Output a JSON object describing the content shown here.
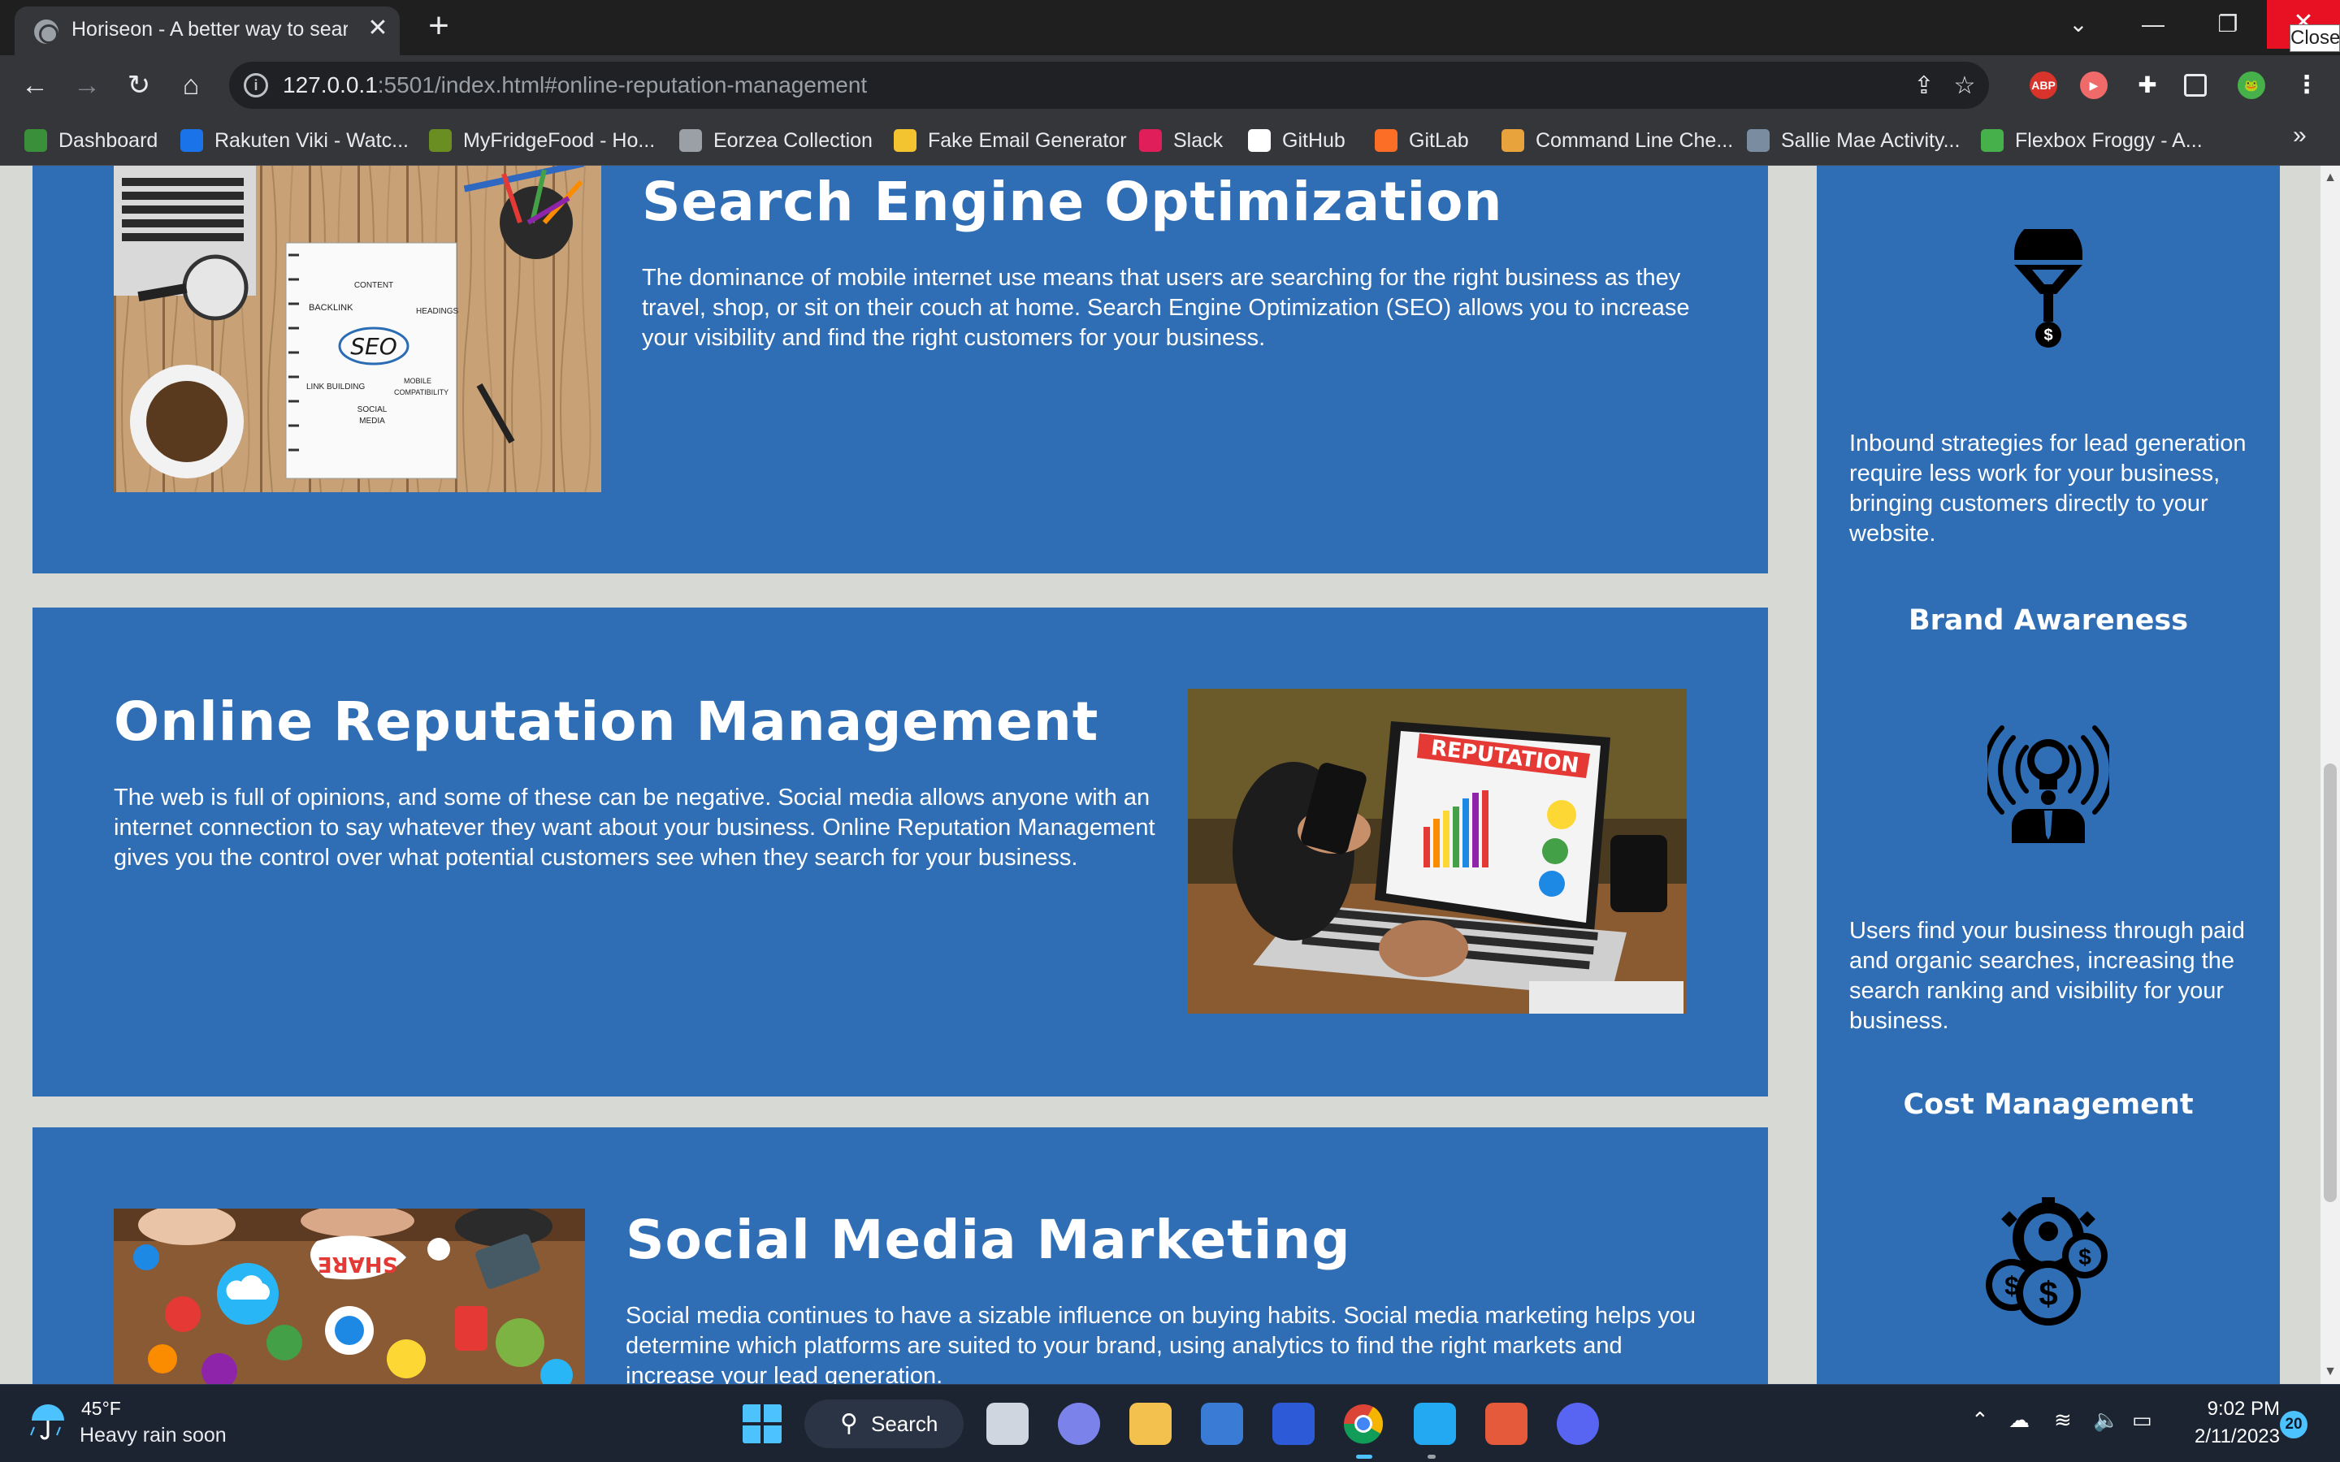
{
  "browser": {
    "tab_title": "Horiseon - A better way to search",
    "tab_close_glyph": "✕",
    "new_tab_glyph": "+",
    "close_tooltip": "Close",
    "url_host": "127.0.0.1",
    "url_rest": ":5501/index.html#online-reputation-management",
    "bookmarks": [
      {
        "label": "Dashboard",
        "icon": "frog-icon",
        "color": "#3a8f3a"
      },
      {
        "label": "Rakuten Viki - Watc...",
        "icon": "rakuten-icon",
        "color": "#1a73e8"
      },
      {
        "label": "MyFridgeFood - Ho...",
        "icon": "fridge-icon",
        "color": "#6b8e23"
      },
      {
        "label": "Eorzea Collection",
        "icon": "globe-icon",
        "color": "#9aa0a6"
      },
      {
        "label": "Fake Email Generator",
        "icon": "mail-icon",
        "color": "#f4c430"
      },
      {
        "label": "Slack",
        "icon": "slack-icon",
        "color": "#e01e5a"
      },
      {
        "label": "GitHub",
        "icon": "github-icon",
        "color": "#ffffff"
      },
      {
        "label": "GitLab",
        "icon": "gitlab-icon",
        "color": "#fc6d26"
      },
      {
        "label": "Command Line Che...",
        "icon": "terminal-icon",
        "color": "#e8a33c"
      },
      {
        "label": "Sallie Mae Activity...",
        "icon": "salliemae-icon",
        "color": "#7a8ca0"
      },
      {
        "label": "Flexbox Froggy - A...",
        "icon": "frog-icon",
        "color": "#46b04a"
      }
    ],
    "bookmarks_more": "»"
  },
  "content": {
    "seo": {
      "title": "Search Engine Optimization",
      "body": "The dominance of mobile internet use means that users are searching for the right business as they travel, shop, or sit on their couch at home. Search Engine Optimization (SEO) allows you to increase your visibility and find the right customers for your business."
    },
    "orm": {
      "title": "Online Reputation Management",
      "body": "The web is full of opinions, and some of these can be negative. Social media allows anyone with an internet connection to say whatever they want about your business. Online Reputation Management gives you the control over what potential customers see when they search for your business.",
      "image_text": "REPUTATION"
    },
    "smm": {
      "title": "Social Media Marketing",
      "body": "Social media continues to have a sizable influence on buying habits. Social media marketing helps you determine which platforms are suited to your brand, using analytics to find the right markets and increase your lead generation.",
      "image_text": "SHARE"
    },
    "seo_image": {
      "seo": "SEO",
      "content": "CONTENT",
      "backlink": "BACKLINK",
      "headings": "HEADINGS",
      "link_building": "LINK BUILDING",
      "mobile": "MOBILE",
      "compatibility": "COMPATIBILITY",
      "social": "SOCIAL",
      "media": "MEDIA"
    }
  },
  "aside": {
    "lead_body": "Inbound strategies for lead generation require less work for your business, bringing customers directly to your website.",
    "brand_title": "Brand Awareness",
    "brand_body": "Users find your business through paid and organic searches, increasing the search ranking and visibility for your business.",
    "cost_title": "Cost Management"
  },
  "taskbar": {
    "temp": "45°F",
    "weather": "Heavy rain soon",
    "search": "Search",
    "time": "9:02 PM",
    "date": "2/11/2023",
    "notifications": "20"
  }
}
